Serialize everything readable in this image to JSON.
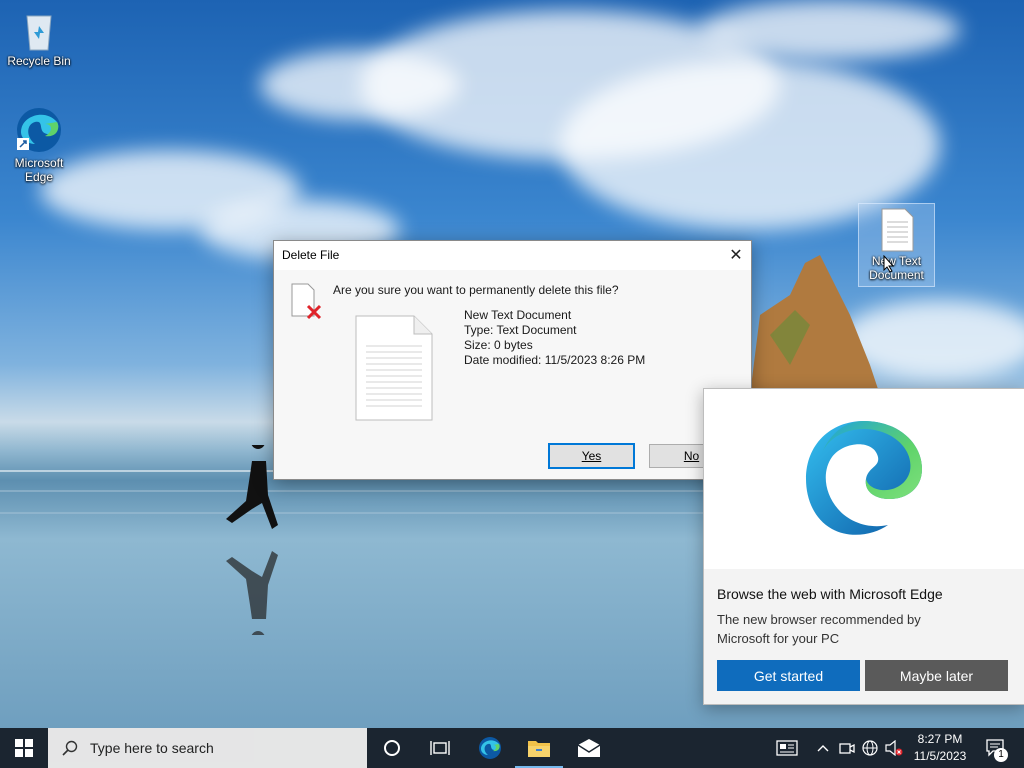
{
  "desktop": {
    "icons": [
      {
        "label": "Recycle Bin"
      },
      {
        "label": "Microsoft Edge"
      },
      {
        "label": "New Text Document"
      }
    ]
  },
  "dialog": {
    "title": "Delete File",
    "close_glyph": "✕",
    "question": "Are you sure you want to permanently delete this file?",
    "file_name": "New Text Document",
    "file_type": "Type: Text Document",
    "file_size": "Size: 0 bytes",
    "file_modified": "Date modified: 11/5/2023 8:26 PM",
    "yes_label": "Yes",
    "no_label": "No"
  },
  "edge_popup": {
    "title": "Browse the web with Microsoft Edge",
    "description": "The new browser recommended by Microsoft for your PC",
    "get_started": "Get started",
    "maybe_later": "Maybe later"
  },
  "taskbar": {
    "search_placeholder": "Type here to search",
    "time": "8:27 PM",
    "date": "11/5/2023",
    "notification_count": "1"
  },
  "colors": {
    "accent": "#0078d7",
    "edge_primary": "#0f6cbd",
    "taskbar": "#1b2530"
  }
}
